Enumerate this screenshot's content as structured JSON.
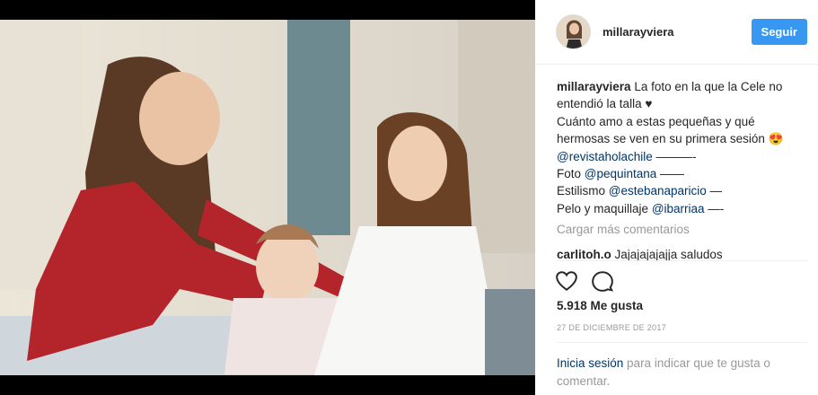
{
  "post": {
    "username": "millarayviera",
    "follow_label": "Seguir",
    "caption_user": "millarayviera",
    "caption_line1": " La foto en la que la Cele no entendió la talla ♥",
    "caption_line2": "Cuánto amo a estas pequeñas y qué hermosas se ven en su primera sesión 😍",
    "mention_hola": "@revistaholachile",
    "dash1": " ———-",
    "foto_label": "Foto ",
    "mention_photo": "@pequintana",
    "dash2": " ——",
    "estilismo_label": "Estilismo ",
    "mention_style": "@estebanaparicio",
    "dash3": " —",
    "pelo_label": "Pelo y maquillaje ",
    "mention_hair": "@ibarriaa",
    "dash4": " —-",
    "load_more": "Cargar más comentarios",
    "comment_user": "carlitoh.o",
    "comment_text": " Jajajajajajja saludos",
    "likes": "5.918 Me gusta",
    "date": "27 DE DICIEMBRE DE 2017",
    "login_link": "Inicia sesión",
    "login_text": " para indicar que te gusta o comentar."
  },
  "icons": {
    "like": "heart-icon",
    "comment": "comment-icon"
  },
  "colors": {
    "accent": "#3897f0",
    "link": "#003569",
    "text": "#262626",
    "muted": "#999999"
  }
}
